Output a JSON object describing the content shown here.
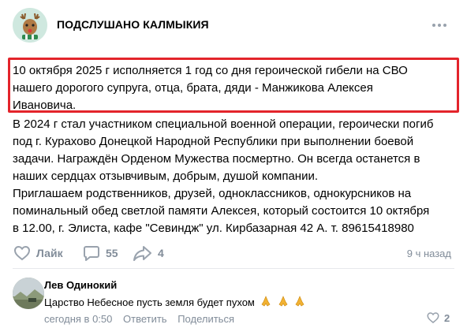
{
  "group": {
    "name": "ПОДСЛУШАНО КАЛМЫКИЯ"
  },
  "post": {
    "highlighted_lines": [
      "10 октября 2025 г исполняется 1 год со дня героической гибели на СВО",
      "нашего дорогого супруга, отца, брата, дяди - Манжикова Алексея",
      "Ивановича."
    ],
    "body_lines": [
      "В 2024 г стал участником специальной военной операции, героически погиб",
      "под г. Курахово Донецкой Народной Республики при выполнении боевой",
      "задачи. Награждён Орденом Мужества посмертно. Он всегда останется в",
      "наших сердцах отзывчивым, добрым, душой компании.",
      "Приглашаем родственников, друзей, одноклассников, однокурсников на",
      "поминальный обед светлой памяти Алексея, который состоится 10 октября",
      "в 12.00, г. Элиста, кафе \"Севиндж\" ул. Кирбазарная 42 А. т. 89615418980"
    ],
    "highlight_color": "#e3242b"
  },
  "actions": {
    "like_label": "Лайк",
    "comments_count": "55",
    "shares_count": "4",
    "time_ago": "9 ч назад"
  },
  "comment": {
    "author": "Лев Одинокий",
    "text": "Царство Небесное пусть земля будет пухом",
    "time": "сегодня в 0:50",
    "reply_label": "Ответить",
    "share_label": "Поделиться",
    "likes": "2"
  },
  "icons": {
    "avatar": "deer-avatar",
    "menu": "more-dots-icon",
    "like": "heart-icon",
    "comment": "comment-icon",
    "share": "share-arrow-icon",
    "emoji": "folded-hands-emoji"
  }
}
